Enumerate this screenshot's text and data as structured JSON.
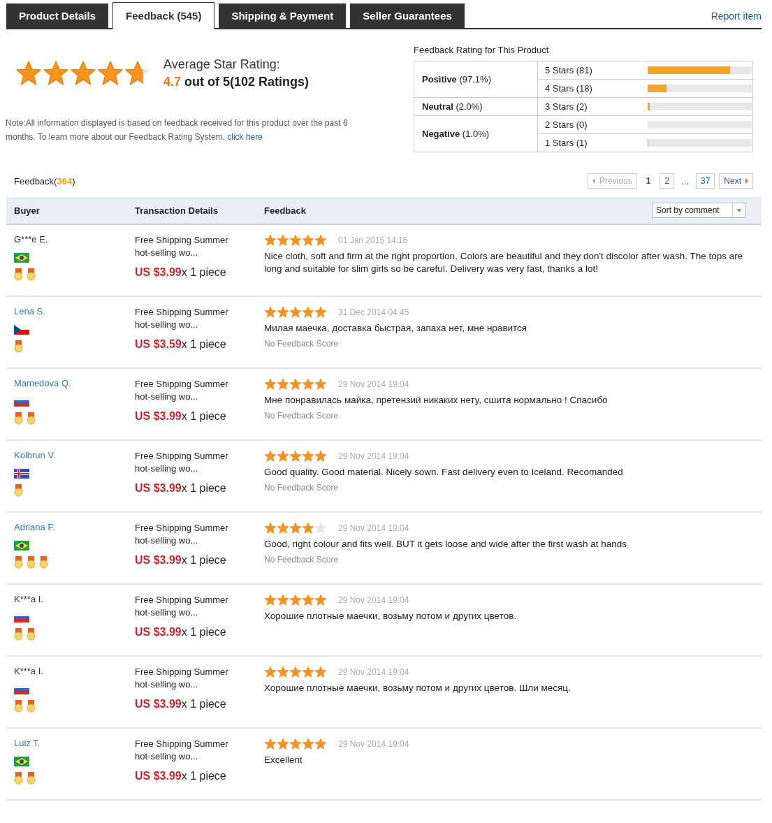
{
  "tabs": [
    {
      "label": "Product Details",
      "selected": false
    },
    {
      "label": "Feedback (545)",
      "selected": true
    },
    {
      "label": "Shipping & Payment",
      "selected": false
    },
    {
      "label": "Seller Guarantees",
      "selected": false
    }
  ],
  "report_link": "Report item",
  "average": {
    "stars": 4.7,
    "title": "Average Star Rating:",
    "score": "4.7",
    "out_of": "out of 5(102 Ratings)"
  },
  "note": {
    "text": "Note:All information displayed is based on feedback received for this product over the past 6 months. To learn more about our Feedback Rating System,",
    "link": "click here"
  },
  "rating_table": {
    "title": "Feedback Rating for This Product",
    "groups": [
      {
        "label": "Positive",
        "share": "(97.1%)",
        "rows": [
          {
            "label": "5 Stars (81)",
            "level": 0.79
          },
          {
            "label": "4 Stars (18)",
            "level": 0.18
          }
        ]
      },
      {
        "label": "Neutral",
        "share": "(2.0%)",
        "rows": [
          {
            "label": "3 Stars (2)",
            "level": 0.02
          }
        ]
      },
      {
        "label": "Negative",
        "share": "(1.0%)",
        "rows": [
          {
            "label": "2 Stars (0)"
          },
          {
            "label": "1 Stars (1)",
            "level": 0.01
          }
        ]
      }
    ]
  },
  "feedback_heading": {
    "label": "Feedback(",
    "count": "364",
    "close": ")"
  },
  "pagination": [
    {
      "label": "Previous",
      "kind": "prev",
      "disabled": true
    },
    {
      "label": "1",
      "kind": "page",
      "selected": true
    },
    {
      "label": "2",
      "kind": "page",
      "selected": false
    },
    {
      "label": "...",
      "kind": "gap"
    },
    {
      "label": "37",
      "kind": "page",
      "selected": false
    },
    {
      "label": "Next",
      "kind": "next",
      "disabled": false
    }
  ],
  "table": {
    "columns": [
      "Buyer",
      "Transaction Details",
      "Feedback"
    ],
    "sort": "Sort by comment",
    "rows": [
      {
        "buyer": "G***e E.",
        "link": false,
        "flag": {
          "kind": "brazil"
        },
        "medals": [
          {
            "kind": "medal"
          },
          {
            "kind": "medal"
          }
        ],
        "product": "Free Shipping Summer hot-selling wo...",
        "price": "US $3.99",
        "quantity": "x 1 piece",
        "stars": 5,
        "date": "01 Jan 2015 14:16",
        "comment": "Nice cloth, soft and firm at the right proportion. Colors are beautiful and they don't discolor after wash. The tops are long and suitable for slim girls so be careful. Delivery was very fast, thanks a lot!"
      },
      {
        "buyer": "Lena S.",
        "link": true,
        "flag": {
          "kind": "czech"
        },
        "medals": [
          {
            "kind": "medal"
          }
        ],
        "product": "Free Shipping Summer hot-selling wo...",
        "price": "US $3.59",
        "quantity": "x 1 piece",
        "stars": 5,
        "date": "31 Dec 2014 04:45",
        "comment": "Милая маечка, доставка быстрая, запаха нет, мне нравится",
        "score": "No Feedback Score"
      },
      {
        "buyer": "Mamedova Q.",
        "link": true,
        "flag": {
          "kind": "russia"
        },
        "medals": [
          {
            "kind": "medal"
          },
          {
            "kind": "medal"
          }
        ],
        "product": "Free Shipping Summer hot-selling wo...",
        "price": "US $3.99",
        "quantity": "x 1 piece",
        "stars": 5,
        "date": "29 Nov 2014 19:04",
        "comment": "Мне понравилась майка, претензий никаких нету, сшита нормально ! Спасибо",
        "score": "No Feedback Score"
      },
      {
        "buyer": "Kolbrun V.",
        "link": true,
        "flag": {
          "kind": "iceland"
        },
        "medals": [
          {
            "kind": "medal"
          }
        ],
        "product": "Free Shipping Summer hot-selling wo...",
        "price": "US $3.99",
        "quantity": "x 1 piece",
        "stars": 5,
        "date": "29 Nov 2014 19:04",
        "comment": "Good quality. Good material. Nicely sown. Fast delivery even to Iceland. Recomanded",
        "score": "No Feedback Score"
      },
      {
        "buyer": "Adriana F.",
        "link": true,
        "flag": {
          "kind": "brazil"
        },
        "medals": [
          {
            "kind": "medal"
          },
          {
            "kind": "medal"
          },
          {
            "kind": "medal"
          }
        ],
        "product": "Free Shipping Summer hot-selling wo...",
        "price": "US $3.99",
        "quantity": "x 1 piece",
        "stars": 4,
        "date": "29 Nov 2014 19:04",
        "comment": "Good, right colour and fits well. BUT it gets loose and wide after the first wash at hands",
        "score": "No Feedback Score"
      },
      {
        "buyer": "K***a I.",
        "link": false,
        "flag": {
          "kind": "russia"
        },
        "medals": [
          {
            "kind": "medal"
          },
          {
            "kind": "medal"
          }
        ],
        "product": "Free Shipping Summer hot-selling wo...",
        "price": "US $3.99",
        "quantity": "x 1 piece",
        "stars": 5,
        "date": "29 Nov 2014 19:04",
        "comment": "Хорошие плотные маечки, возьму потом и других цветов."
      },
      {
        "buyer": "K***a I.",
        "link": false,
        "flag": {
          "kind": "russia"
        },
        "medals": [
          {
            "kind": "medal"
          },
          {
            "kind": "medal"
          }
        ],
        "product": "Free Shipping Summer hot-selling wo...",
        "price": "US $3.99",
        "quantity": "x 1 piece",
        "stars": 5,
        "date": "29 Nov 2014 19:04",
        "comment": "Хорошие плотные маечки, возьму потом и других цветов. Шли месяц."
      },
      {
        "buyer": "Luiz T.",
        "link": true,
        "flag": {
          "kind": "brazil"
        },
        "medals": [
          {
            "kind": "medal"
          },
          {
            "kind": "medal"
          }
        ],
        "product": "Free Shipping Summer hot-selling wo...",
        "price": "US $3.99",
        "quantity": "x 1 piece",
        "stars": 5,
        "date": "29 Nov 2014 19:04",
        "comment": "Excellent"
      }
    ]
  }
}
